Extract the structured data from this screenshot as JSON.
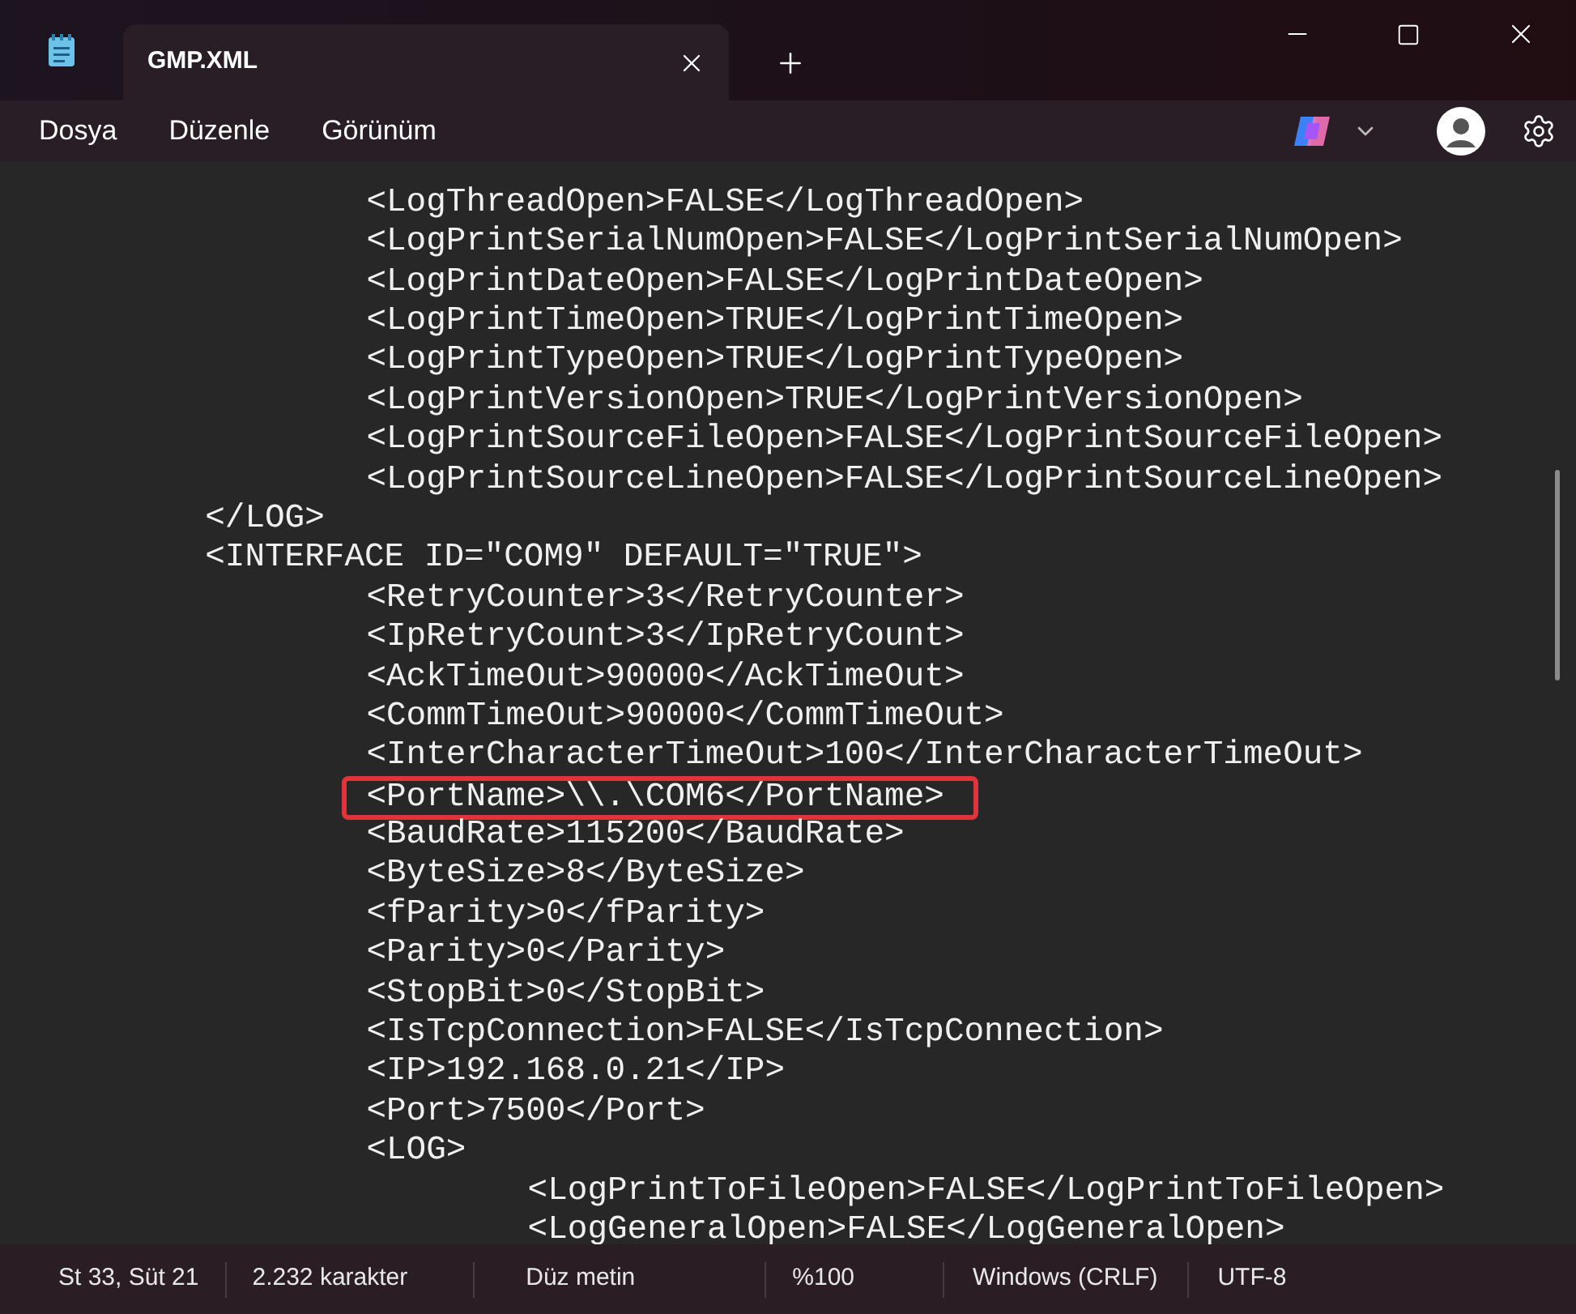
{
  "app": {
    "tab": {
      "title": "GMP.XML",
      "selected": true
    }
  },
  "menu": [
    "Dosya",
    "Düzenle",
    "Görünüm"
  ],
  "editor": {
    "lines": [
      {
        "text": "\t\t<LogThreadOpen>FALSE</LogThreadOpen>",
        "highlighted": false
      },
      {
        "text": "\t\t<LogPrintSerialNumOpen>FALSE</LogPrintSerialNumOpen>",
        "highlighted": false
      },
      {
        "text": "\t\t<LogPrintDateOpen>FALSE</LogPrintDateOpen>",
        "highlighted": false
      },
      {
        "text": "\t\t<LogPrintTimeOpen>TRUE</LogPrintTimeOpen>",
        "highlighted": false
      },
      {
        "text": "\t\t<LogPrintTypeOpen>TRUE</LogPrintTypeOpen>",
        "highlighted": false
      },
      {
        "text": "\t\t<LogPrintVersionOpen>TRUE</LogPrintVersionOpen>",
        "highlighted": false
      },
      {
        "text": "\t\t<LogPrintSourceFileOpen>FALSE</LogPrintSourceFileOpen>",
        "highlighted": false
      },
      {
        "text": "\t\t<LogPrintSourceLineOpen>FALSE</LogPrintSourceLineOpen>",
        "highlighted": false
      },
      {
        "text": "\t</LOG>",
        "highlighted": false
      },
      {
        "text": "\t<INTERFACE ID=\"COM9\" DEFAULT=\"TRUE\">",
        "highlighted": false
      },
      {
        "text": "\t\t<RetryCounter>3</RetryCounter>",
        "highlighted": false
      },
      {
        "text": "\t\t<IpRetryCount>3</IpRetryCount>",
        "highlighted": false
      },
      {
        "text": "\t\t<AckTimeOut>90000</AckTimeOut>",
        "highlighted": false
      },
      {
        "text": "\t\t<CommTimeOut>90000</CommTimeOut>",
        "highlighted": false
      },
      {
        "text": "\t\t<InterCharacterTimeOut>100</InterCharacterTimeOut>",
        "highlighted": false
      },
      {
        "text": "\t\t<PortName>\\\\.\\COM6</PortName>",
        "highlighted": true
      },
      {
        "text": "\t\t<BaudRate>115200</BaudRate>",
        "highlighted": false
      },
      {
        "text": "\t\t<ByteSize>8</ByteSize>",
        "highlighted": false
      },
      {
        "text": "\t\t<fParity>0</fParity>",
        "highlighted": false
      },
      {
        "text": "\t\t<Parity>0</Parity>",
        "highlighted": false
      },
      {
        "text": "\t\t<StopBit>0</StopBit>",
        "highlighted": false
      },
      {
        "text": "\t\t<IsTcpConnection>FALSE</IsTcpConnection>",
        "highlighted": false
      },
      {
        "text": "\t\t<IP>192.168.0.21</IP>",
        "highlighted": false
      },
      {
        "text": "\t\t<Port>7500</Port>",
        "highlighted": false
      },
      {
        "text": "\t\t<LOG>",
        "highlighted": false
      },
      {
        "text": "\t\t\t<LogPrintToFileOpen>FALSE</LogPrintToFileOpen>",
        "highlighted": false
      },
      {
        "text": "\t\t\t<LogGeneralOpen>FALSE</LogGeneralOpen>",
        "highlighted": false
      }
    ]
  },
  "status_bar": [
    "St 33, Süt 21",
    "2.232 karakter",
    "Düz metin",
    "%100",
    "Windows (CRLF)",
    "UTF-8"
  ]
}
